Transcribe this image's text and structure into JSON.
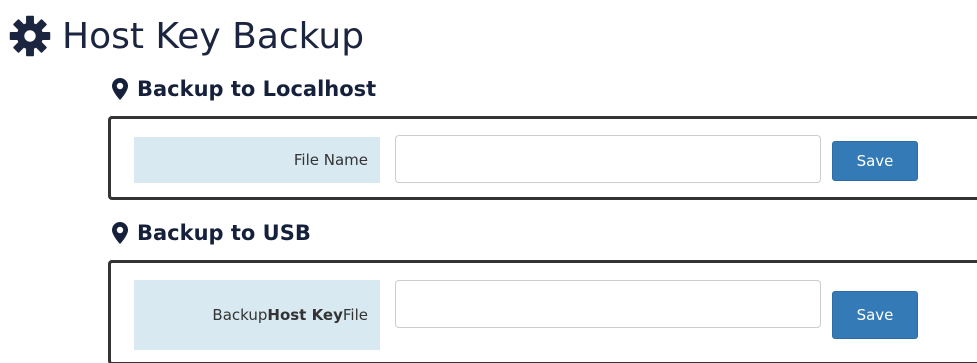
{
  "header": {
    "icon": "gear-icon",
    "title": "Host Key Backup"
  },
  "sections": [
    {
      "icon": "map-marker-icon",
      "title": "Backup to Localhost",
      "label": "File Name",
      "input_value": "",
      "save_label": "Save"
    },
    {
      "icon": "map-marker-icon",
      "title": "Backup to USB",
      "label_pre": "Backup ",
      "label_bold": "Host Key",
      "label_post": " File",
      "input_value": "",
      "save_label": "Save"
    }
  ],
  "colors": {
    "accent": "#337ab7",
    "label_bg": "#d8e9f2",
    "heading": "#15213a"
  }
}
